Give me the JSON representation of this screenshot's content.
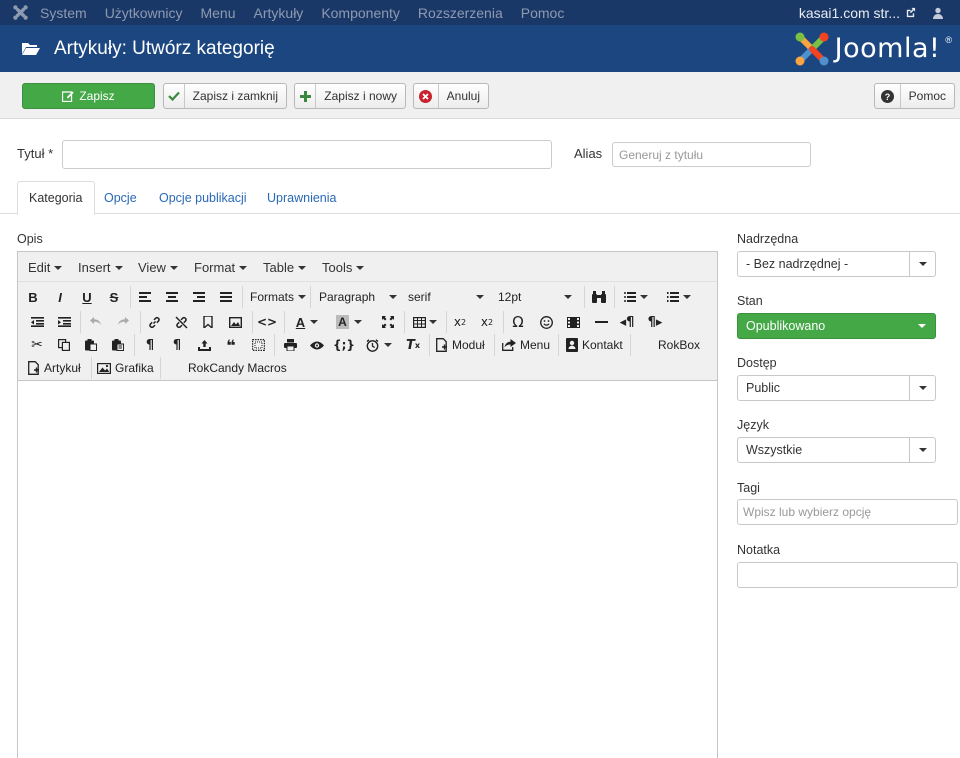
{
  "topnav": {
    "items": [
      "System",
      "Użytkownicy",
      "Menu",
      "Artykuły",
      "Komponenty",
      "Rozszerzenia",
      "Pomoc"
    ],
    "site_link": "kasai1.com str..."
  },
  "header": {
    "title": "Artykuły: Utwórz kategorię",
    "brand": "Joomla!",
    "brand_reg": "®"
  },
  "toolbar": {
    "save": "Zapisz",
    "save_close": "Zapisz i zamknij",
    "save_new": "Zapisz i nowy",
    "cancel": "Anuluj",
    "help": "Pomoc"
  },
  "form": {
    "title_label": "Tytuł *",
    "title_value": "",
    "alias_label": "Alias",
    "alias_placeholder": "Generuj z tytułu"
  },
  "tabs": [
    "Kategoria",
    "Opcje",
    "Opcje publikacji",
    "Uprawnienia"
  ],
  "editor": {
    "label": "Opis",
    "menus": [
      "Edit",
      "Insert",
      "View",
      "Format",
      "Table",
      "Tools"
    ],
    "formats": "Formats",
    "block": "Paragraph",
    "font_family": "serif",
    "font_size": "12pt",
    "module_btn": "Moduł",
    "menu_btn": "Menu",
    "contact_btn": "Kontakt",
    "rokbox": "RokBox",
    "article_btn": "Artykuł",
    "image_btn": "Grafika",
    "rokcandy": "RokCandy Macros",
    "text_color_letter": "A",
    "bg_color_letter": "A",
    "code_sample": "{;}"
  },
  "sidebar": {
    "parent_label": "Nadrzędna",
    "parent_value": "- Bez nadrzędnej -",
    "status_label": "Stan",
    "status_value": "Opublikowano",
    "access_label": "Dostęp",
    "access_value": "Public",
    "language_label": "Język",
    "language_value": "Wszystkie",
    "tags_label": "Tagi",
    "tags_placeholder": "Wpisz lub wybierz opcję",
    "note_label": "Notatka",
    "note_value": ""
  },
  "colors": {
    "topnav": "#1a3867",
    "header": "#1b4680",
    "green": "#44a847",
    "link": "#2a69b8"
  }
}
